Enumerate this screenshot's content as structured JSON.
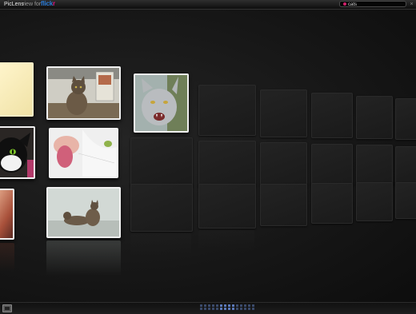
{
  "header": {
    "app_name": "PicLens",
    "view_for": "view for",
    "flickr_part1": "flick",
    "flickr_part2": "r"
  },
  "search": {
    "query": "cats"
  },
  "photos": [
    {
      "id": "cream-tile",
      "subject": "pale cream image"
    },
    {
      "id": "tabby-kitchen",
      "subject": "tabby cat sitting in kitchen"
    },
    {
      "id": "grey-cat-hissing",
      "subject": "grey cat with mouth open"
    },
    {
      "id": "black-white-cat",
      "subject": "black and white cat"
    },
    {
      "id": "cat-closeup",
      "subject": "close-up of cat nose and tongue"
    },
    {
      "id": "orange-partial",
      "subject": "orange cat partial"
    },
    {
      "id": "two-tabbies-lying",
      "subject": "two tabby cats lying"
    }
  ],
  "colors": {
    "flickr_blue": "#2a7bd8",
    "flickr_pink": "#e0137f",
    "background": "#141414"
  }
}
